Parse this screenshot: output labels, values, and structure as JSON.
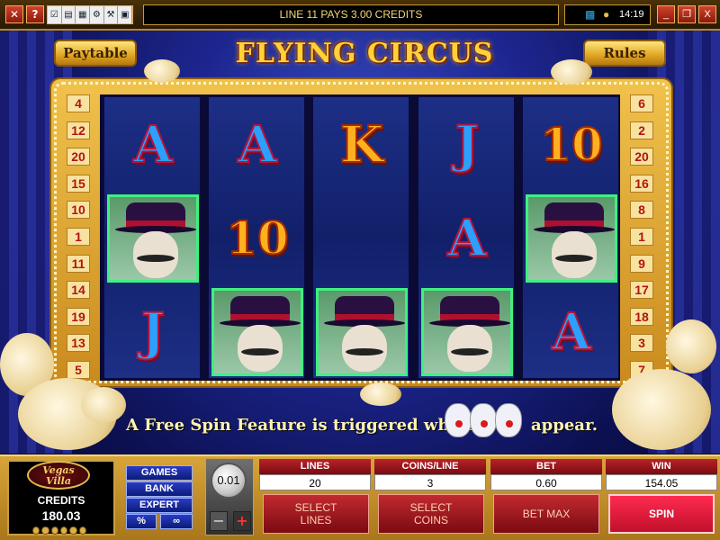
{
  "topbar": {
    "close_icon": "x-close-icon",
    "help_label": "?",
    "message": "LINE 11 PAYS 3.00 CREDITS",
    "clock": "14:19",
    "window_controls": [
      "_",
      "❐",
      "X"
    ]
  },
  "header": {
    "paytable": "Paytable",
    "title": "FLYING CIRCUS",
    "rules": "Rules"
  },
  "reels": [
    [
      "A",
      "WILD",
      "J"
    ],
    [
      "A",
      "10",
      "WILD"
    ],
    [
      "K",
      "",
      "WILD"
    ],
    [
      "J",
      "A",
      "WILD"
    ],
    [
      "10",
      "WILD",
      "A"
    ]
  ],
  "left_lines": [
    "4",
    "12",
    "20",
    "15",
    "10",
    "1",
    "11",
    "14",
    "19",
    "13",
    "5"
  ],
  "right_lines": [
    "6",
    "2",
    "20",
    "16",
    "8",
    "1",
    "9",
    "17",
    "18",
    "3",
    "7"
  ],
  "feature": {
    "text": "A Free Spin Feature is triggered when",
    "text_end": "appear."
  },
  "panel": {
    "logo_line1": "Vegas",
    "logo_line2": "Villa",
    "credits_label": "CREDITS",
    "credits_value": "180.03",
    "menu": {
      "games": "GAMES",
      "bank": "BANK",
      "expert": "EXPERT",
      "percent": "%",
      "sound": "∞"
    },
    "coin_value": "0.01",
    "minus": "−",
    "plus": "+",
    "lines_label": "LINES",
    "lines_value": "20",
    "coins_label": "COINS/LINE",
    "coins_value": "3",
    "bet_label": "BET",
    "bet_value": "0.60",
    "win_label": "WIN",
    "win_value": "154.05",
    "select_lines_1": "SELECT",
    "select_lines_2": "LINES",
    "select_coins_1": "SELECT",
    "select_coins_2": "COINS",
    "bet_max": "BET MAX",
    "spin": "SPIN"
  },
  "colors": {
    "accent_gold": "#e0a520",
    "reel_blue": "#1d2f86",
    "spin_red": "#ff2a50"
  }
}
